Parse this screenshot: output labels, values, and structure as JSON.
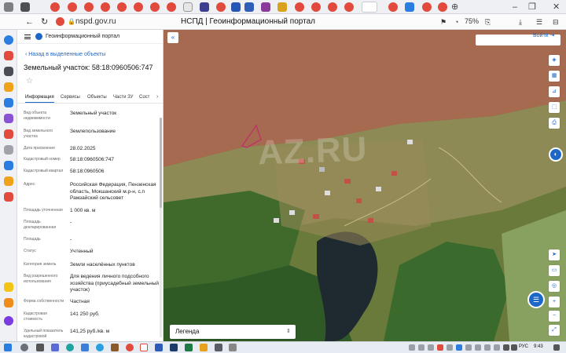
{
  "browser": {
    "url": "nspd.gov.ru",
    "page_title": "НСПД | Геоинформационный портал",
    "zoom": "75%"
  },
  "panel": {
    "portal_name": "Геоинформационный портал",
    "back_link": "Назад в выделенные объекты",
    "title": "Земельный участок: 58:18:0960506:747",
    "tabs": [
      "Информация",
      "Сервисы",
      "Объекты",
      "Части ЗУ",
      "Сост"
    ],
    "properties": [
      {
        "label": "Вид объекта недвижимости",
        "value": "Земельный участок"
      },
      {
        "label": "Вид земельного участка",
        "value": "Землепользование"
      },
      {
        "label": "Дата присвоения",
        "value": "28.02.2025"
      },
      {
        "label": "Кадастровый номер",
        "value": "58:18:0960506:747"
      },
      {
        "label": "Кадастровый квартал",
        "value": "58:18:0960506"
      },
      {
        "label": "Адрес",
        "value": "Российская Федерация, Пензенская область, Мокшанский м.р-н, с.п Рамзайский сельсовет"
      },
      {
        "label": "Площадь уточненная",
        "value": "1 000 кв. м"
      },
      {
        "label": "Площадь декларированная",
        "value": "-"
      },
      {
        "label": "Площадь",
        "value": "-"
      },
      {
        "label": "Статус",
        "value": "Учтенный"
      },
      {
        "label": "Категория земель",
        "value": "Земли населённых пунктов"
      },
      {
        "label": "Вид разрешенного использования",
        "value": "Для ведения личного подсобного хозяйства (приусадебный земельный участок)"
      },
      {
        "label": "Форма собственности",
        "value": "Частная"
      },
      {
        "label": "Кадастровая стоимость",
        "value": "141 250 руб."
      },
      {
        "label": "Удельный показатель кадастровой",
        "value": "141,25 руб./кв. м"
      }
    ]
  },
  "map": {
    "login": "Войти",
    "legend": "Легенда",
    "watermark": "AZ.RU"
  },
  "taskbar": {
    "language": "РУС",
    "time": "9:43"
  },
  "colors": {
    "accent": "#1d67c7",
    "parcel_outline": "#c0306a"
  }
}
